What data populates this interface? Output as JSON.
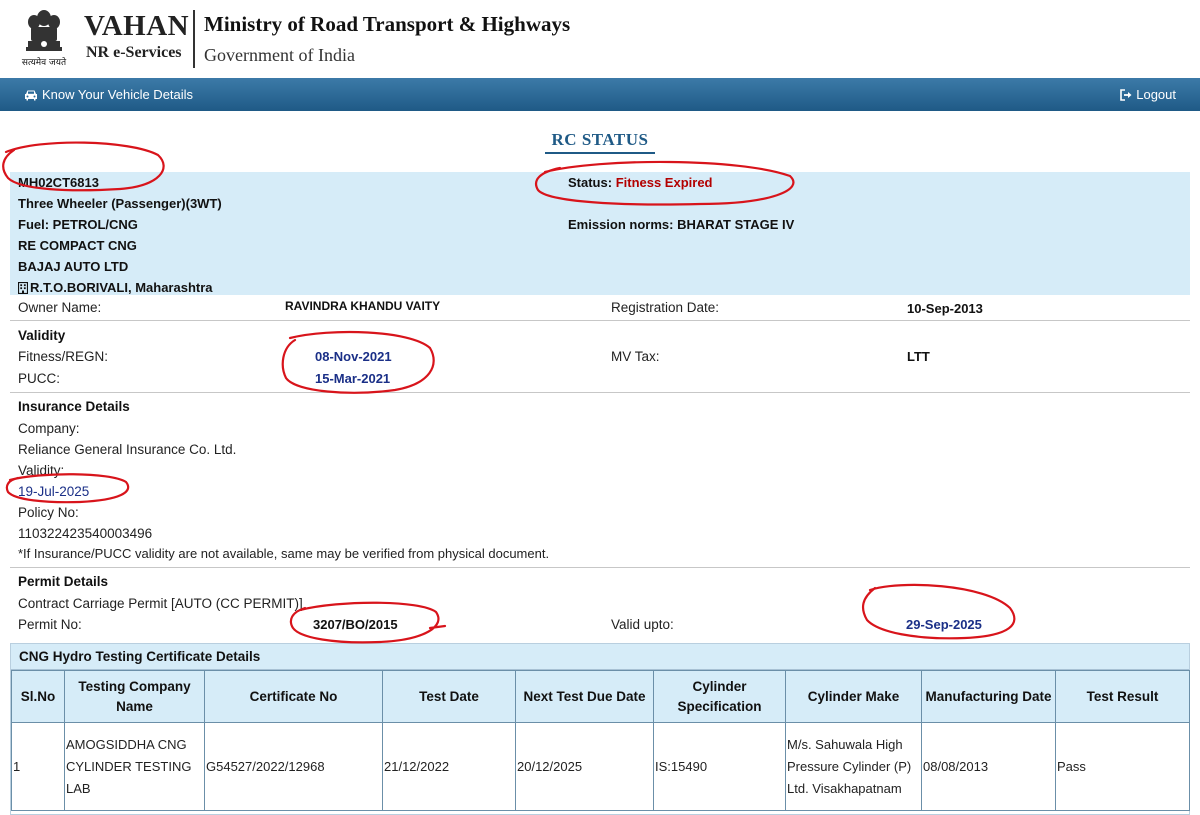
{
  "header": {
    "emblem_caption": "सत्यमेव जयते",
    "app_title": "VAHAN",
    "app_subtitle": "NR e-Services",
    "ministry": "Ministry of Road Transport & Highways",
    "government": "Government of India"
  },
  "nav": {
    "left_icon": "car-icon",
    "left_label": "Know Your Vehicle Details",
    "right_icon": "logout-icon",
    "right_label": "Logout",
    "bar_color": "#1f5a86"
  },
  "page_title": "RC STATUS",
  "vehicle": {
    "registration_no": "MH02CT6813",
    "vehicle_class": "Three Wheeler (Passenger)(3WT)",
    "fuel": "Fuel: PETROL/CNG",
    "model": "RE COMPACT CNG",
    "maker": "BAJAJ AUTO LTD",
    "rto_icon": "building-icon",
    "rto": "R.T.O.BORIVALI, Maharashtra",
    "status_label": "Status:",
    "status_value": "Fitness Expired",
    "emission": "Emission norms: BHARAT STAGE IV",
    "highlight_color": "#d6ecf8"
  },
  "owner": {
    "owner_label": "Owner Name:",
    "owner_value": "RAVINDRA KHANDU VAITY",
    "reg_date_label": "Registration Date:",
    "reg_date_value": "10-Sep-2013"
  },
  "validity": {
    "title": "Validity",
    "fitness_label": "Fitness/REGN:",
    "fitness_value": "08-Nov-2021",
    "pucc_label": "PUCC:",
    "pucc_value": "15-Mar-2021",
    "mvtax_label": "MV Tax:",
    "mvtax_value": "LTT"
  },
  "insurance": {
    "title": "Insurance Details",
    "company_label": "Company:",
    "company_value": "Reliance General Insurance Co. Ltd.",
    "validity_label": "Validity:",
    "validity_value": "19-Jul-2025",
    "policy_label": "Policy No:",
    "policy_value": "110322423540003496",
    "note": "*If Insurance/PUCC validity are not available, same may be verified from physical document."
  },
  "permit": {
    "title": "Permit Details",
    "type": "Contract Carriage Permit [AUTO (CC PERMIT)]",
    "permit_no_label": "Permit No:",
    "permit_no_value": "3207/BO/2015",
    "valid_upto_label": "Valid upto:",
    "valid_upto_value": "29-Sep-2025"
  },
  "cng": {
    "title": "CNG Hydro Testing Certificate Details",
    "headers": [
      "Sl.No",
      "Testing Company Name",
      "Certificate No",
      "Test Date",
      "Next Test Due Date",
      "Cylinder Specification",
      "Cylinder Make",
      "Manufacturing Date",
      "Test Result"
    ],
    "rows": [
      [
        "1",
        "AMOGSIDDHA CNG CYLINDER TESTING LAB",
        "G54527/2022/12968",
        "21/12/2022",
        "20/12/2025",
        "IS:15490",
        "M/s. Sahuwala High Pressure Cylinder (P) Ltd. Visakhapatnam",
        "08/08/2013",
        "Pass"
      ]
    ]
  },
  "colors": {
    "accent_blue": "#1f5a86",
    "date_blue": "#1a2f87",
    "status_red": "#b30000",
    "annotation_red": "#d8141b"
  }
}
